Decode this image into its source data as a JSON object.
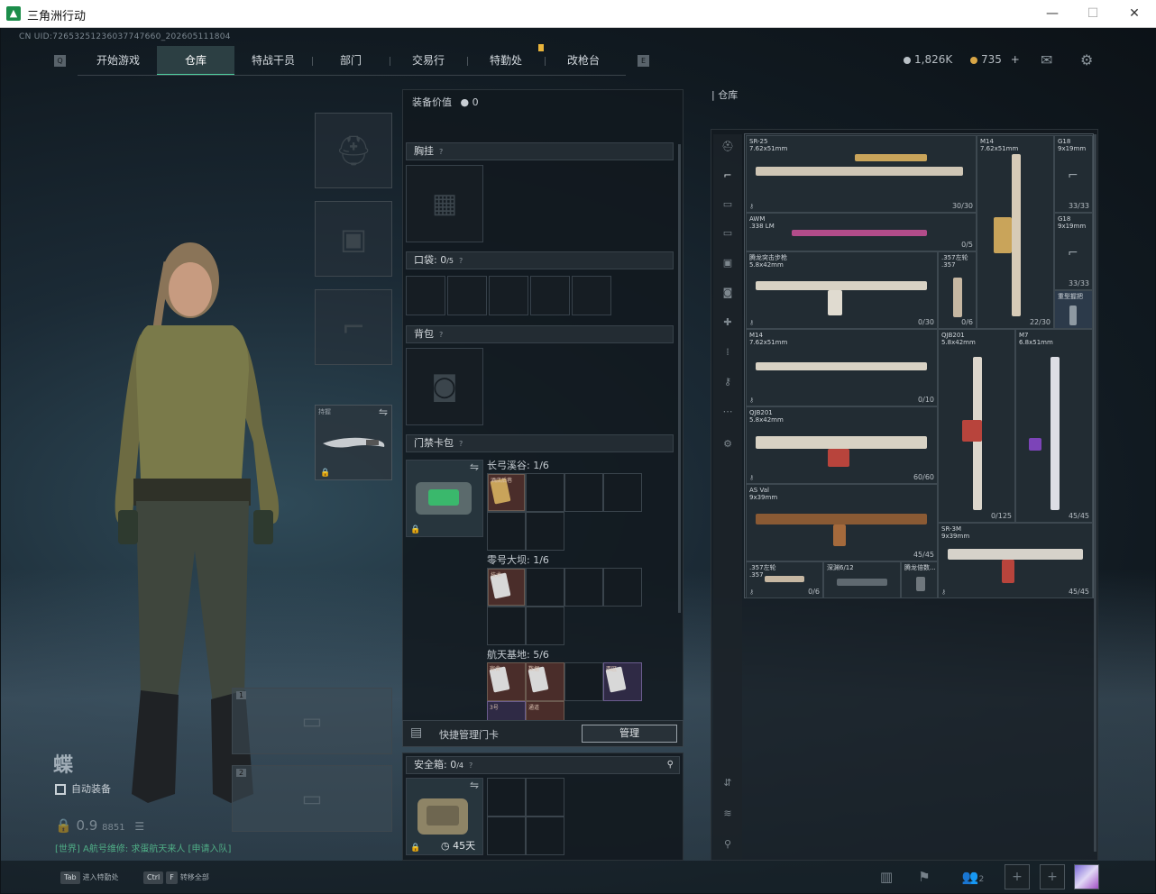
{
  "window": {
    "title": "三角洲行动",
    "min": "—",
    "max": "☐",
    "close": "✕"
  },
  "uid": "CN UID:72653251236037747660_202605111804",
  "nav": {
    "left_key": "Q",
    "right_key": "E",
    "tabs": [
      "开始游戏",
      "仓库",
      "特战干员",
      "部门",
      "交易行",
      "特勤处",
      "改枪台"
    ],
    "active": "仓库"
  },
  "currency": {
    "silver": "1,826K",
    "gold": "735",
    "gold_add": "+",
    "silver_color": "#b9c0c6",
    "gold_color": "#d9a646"
  },
  "icons": {
    "mail": "mail-icon",
    "settings": "gear-icon"
  },
  "loadout": {
    "melee_label": "持握",
    "item_slots": [
      "1",
      "2"
    ],
    "codename": "蝶",
    "auto_equip": "自动装备",
    "ready": "0.9",
    "ready_sub": "8851"
  },
  "chat": {
    "text": "[世界] A航号维修: 求蛋航天来人 [申请入队]"
  },
  "center": {
    "value_label": "装备价值",
    "value": "0",
    "chest_rig": "胸挂",
    "pockets_label": "口袋:",
    "pockets_value": "0",
    "pockets_total": "/5",
    "backpack": "背包",
    "keycard_case": "门禁卡包",
    "keycard_maps": [
      {
        "name": "长弓溪谷:",
        "count": "1/6",
        "cards": [
          "酒店后巷"
        ]
      },
      {
        "name": "零号大坝:",
        "count": "1/6",
        "cards": [
          "技术"
        ]
      },
      {
        "name": "航天基地:",
        "count": "5/6",
        "cards": [
          "宿舍",
          "数据",
          "西区",
          "3号",
          "通道"
        ]
      }
    ],
    "quick_manage": "快捷管理门卡",
    "manage_btn": "管理",
    "safe_label": "安全箱:",
    "safe_value": "0",
    "safe_total": "/4",
    "safe_days": "45天"
  },
  "warehouse": {
    "title": "仓库",
    "items": [
      {
        "name": "SR-25\n7.62x51mm",
        "ammo": "30/30"
      },
      {
        "name": "M14\n7.62x51mm",
        "ammo": "22/30"
      },
      {
        "name": "G18\n9x19mm",
        "ammo": "33/33"
      },
      {
        "name": "G18\n9x19mm",
        "ammo": "33/33"
      },
      {
        "name": "AWM\n.338 LM",
        "ammo": "0/5"
      },
      {
        "name": "腾龙突击步枪\n5.8x42mm",
        "ammo": "0/30"
      },
      {
        "name": ".357左轮\n.357",
        "ammo": "0/6"
      },
      {
        "name": "重型握把",
        "ammo": ""
      },
      {
        "name": "M14\n7.62x51mm",
        "ammo": "0/10"
      },
      {
        "name": "QJB201\n5.8x42mm",
        "ammo": "0/125"
      },
      {
        "name": "M7\n6.8x51mm",
        "ammo": "45/45"
      },
      {
        "name": "QJB201\n5.8x42mm",
        "ammo": "60/60"
      },
      {
        "name": "AS Val\n9x39mm",
        "ammo": "45/45"
      },
      {
        "name": "SR-3M\n9x39mm",
        "ammo": "45/45"
      },
      {
        "name": ".357左轮\n.357",
        "ammo": "0/6"
      },
      {
        "name": "深渊6/12",
        "ammo": ""
      },
      {
        "name": "腾龙倍数...",
        "ammo": ""
      }
    ]
  },
  "bottom": {
    "tab_key": "Tab",
    "tab_label": "进入特勤处",
    "ctrl_key": "Ctrl",
    "f_key": "F",
    "ctrl_label": "转移全部",
    "party_count": "2"
  }
}
